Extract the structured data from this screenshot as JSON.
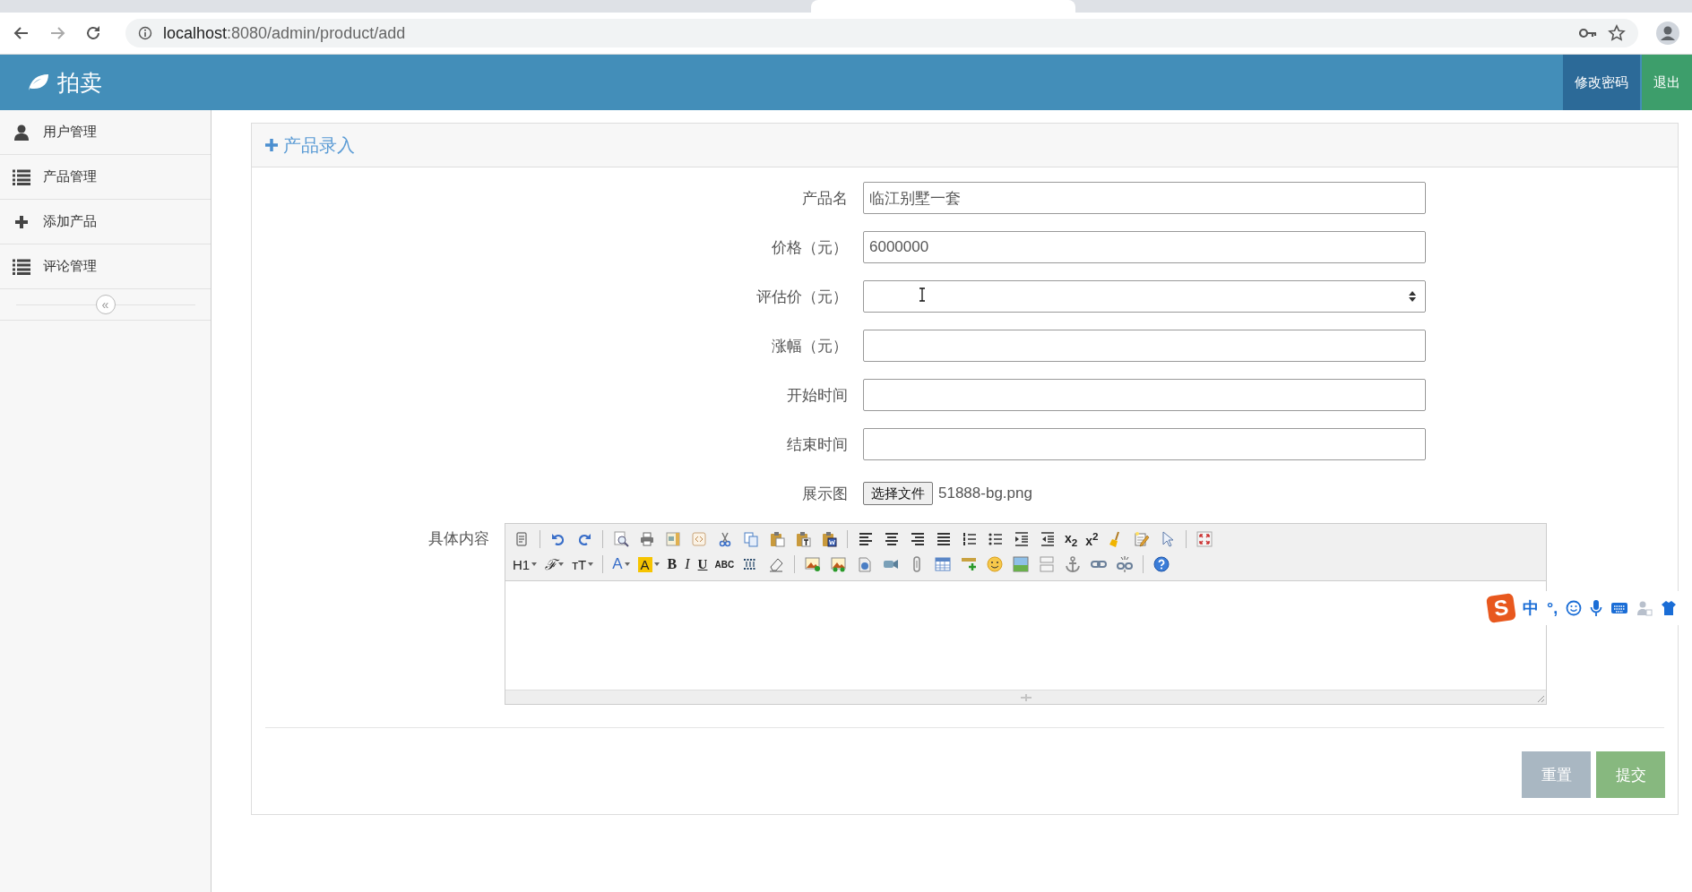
{
  "browser": {
    "url": {
      "host": "localhost",
      "path": ":8080/admin/product/add"
    }
  },
  "header": {
    "brand": "拍卖",
    "buttons": [
      {
        "label": "修改密码",
        "kind": "primary"
      },
      {
        "label": "退出",
        "kind": "success"
      }
    ]
  },
  "sidebar": {
    "items": [
      {
        "label": "用户管理"
      },
      {
        "label": "产品管理"
      },
      {
        "label": "添加产品"
      },
      {
        "label": "评论管理"
      }
    ],
    "collapse": "«"
  },
  "panel": {
    "title": "产品录入"
  },
  "fields": [
    {
      "label": "产品名",
      "kind": "text",
      "value": "临江别墅一套"
    },
    {
      "label": "价格（元）",
      "kind": "text",
      "value": "6000000"
    },
    {
      "label": "评估价（元）",
      "kind": "number"
    },
    {
      "label": "涨幅（元）",
      "kind": "text"
    },
    {
      "label": "开始时间",
      "kind": "text"
    },
    {
      "label": "结束时间",
      "kind": "text"
    },
    {
      "label": "展示图",
      "kind": "file",
      "button": "选择文件",
      "file_name": "51888-bg.png"
    }
  ],
  "editor": {
    "label": "具体内容",
    "toolbar": [
      [
        {
          "kind": "icon"
        },
        {
          "kind": "sep"
        },
        {
          "kind": "icon"
        },
        {
          "kind": "icon"
        },
        {
          "kind": "sep"
        },
        {
          "kind": "icon"
        },
        {
          "kind": "icon"
        },
        {
          "kind": "icon"
        },
        {
          "kind": "icon"
        },
        {
          "kind": "icon"
        },
        {
          "kind": "icon"
        },
        {
          "kind": "icon"
        },
        {
          "kind": "icon"
        },
        {
          "kind": "icon"
        },
        {
          "kind": "sep"
        },
        {
          "kind": "icon"
        },
        {
          "kind": "icon"
        },
        {
          "kind": "icon"
        },
        {
          "kind": "icon"
        },
        {
          "kind": "icon"
        },
        {
          "kind": "icon"
        },
        {
          "kind": "icon"
        },
        {
          "kind": "icon"
        },
        {
          "kind": "text",
          "label": "x$_{2}$",
          "dropdown": false
        },
        {
          "kind": "text",
          "label": "x$^{2}$",
          "dropdown": false
        },
        {
          "kind": "icon"
        },
        {
          "kind": "icon"
        },
        {
          "kind": "icon"
        },
        {
          "kind": "sep"
        },
        {
          "kind": "icon"
        }
      ],
      [
        {
          "kind": "text",
          "label": "H1",
          "dropdown": true
        },
        {
          "kind": "text",
          "label": "ℱ",
          "dropdown": true
        },
        {
          "kind": "text",
          "label": "тT",
          "dropdown": true
        },
        {
          "kind": "sep"
        },
        {
          "kind": "text",
          "label": "A",
          "dropdown": true
        },
        {
          "kind": "text",
          "label": "A",
          "dropdown": true
        },
        {
          "kind": "text",
          "label": "B",
          "dropdown": false
        },
        {
          "kind": "text",
          "label": "I",
          "dropdown": false
        },
        {
          "kind": "text",
          "label": "U",
          "dropdown": false
        },
        {
          "kind": "text",
          "label": "ABC",
          "dropdown": false
        },
        {
          "kind": "icon"
        },
        {
          "kind": "icon"
        },
        {
          "kind": "sep"
        },
        {
          "kind": "icon"
        },
        {
          "kind": "icon"
        },
        {
          "kind": "icon"
        },
        {
          "kind": "icon"
        },
        {
          "kind": "icon"
        },
        {
          "kind": "icon"
        },
        {
          "kind": "icon"
        },
        {
          "kind": "icon"
        },
        {
          "kind": "icon"
        },
        {
          "kind": "icon"
        },
        {
          "kind": "icon"
        },
        {
          "kind": "icon"
        },
        {
          "kind": "icon"
        },
        {
          "kind": "sep"
        },
        {
          "kind": "icon"
        }
      ]
    ]
  },
  "buttons": [
    {
      "label": "重置",
      "kind": "reset"
    },
    {
      "label": "提交",
      "kind": "submit"
    }
  ],
  "ime": {
    "logo": "S",
    "mode": "中",
    "punct": "°,"
  }
}
